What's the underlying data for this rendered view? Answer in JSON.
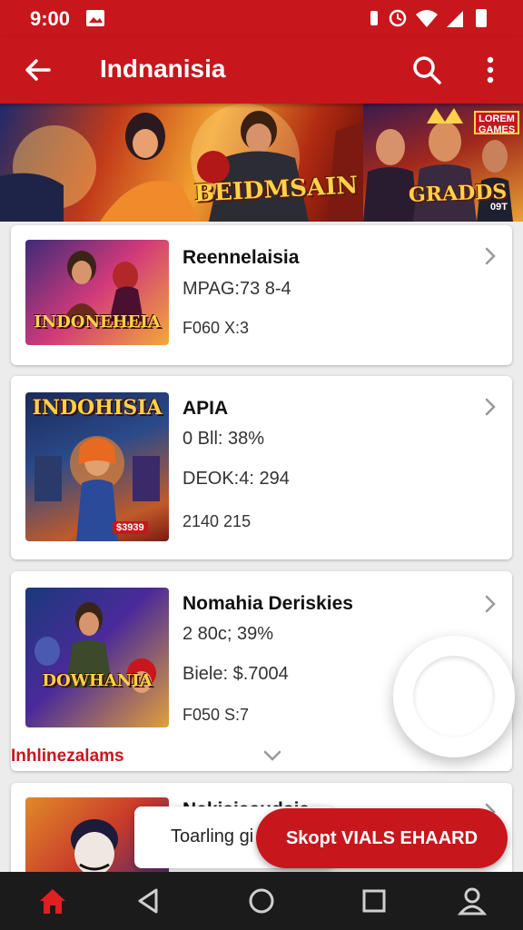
{
  "status_bar": {
    "time": "9:00",
    "icons": [
      "image-icon",
      "vibrate-icon",
      "alarm-icon",
      "wifi-icon",
      "signal-icon",
      "battery-icon"
    ]
  },
  "app_bar": {
    "title": "Indnanisia",
    "icons": [
      "back-arrow-icon",
      "search-icon",
      "more-vertical-icon"
    ]
  },
  "banner": {
    "logo_left": "BEIDMSAIN",
    "logo_right": "GRADDS",
    "badge": "LOREM GAMES",
    "badge_sub": "09T"
  },
  "cards": [
    {
      "thumb_text": "INDONEHEIA",
      "title": "Reennelaisia",
      "lines": [
        "MPAG:73 8-4",
        "F060 X:3"
      ]
    },
    {
      "thumb_text": "INDOHISIA",
      "title": "APIA",
      "lines": [
        "0 Bll: 38%",
        "DEOK:4: 294",
        "2140 215"
      ],
      "thumb_badge": "$3939"
    },
    {
      "thumb_text": "DOWHANIA",
      "title": "Nomahia Deriskies",
      "lines": [
        "2 80c; 39%",
        "Biele: $.7004",
        "F050 S:7"
      ],
      "sublink": "Inhlinezalams"
    },
    {
      "title": "Nekisiaaudsia"
    }
  ],
  "toast": {
    "text": "Toarling gi"
  },
  "cta": {
    "label": "Skopt VIALS EHAARD"
  },
  "colors": {
    "primary": "#c8161d",
    "nav_bg": "#1b1b1b",
    "accent_gold": "#ffd24a"
  },
  "nav_bar": {
    "icons": [
      "home-icon",
      "back-triangle-icon",
      "home-circle-icon",
      "recents-square-icon",
      "profile-icon"
    ]
  }
}
